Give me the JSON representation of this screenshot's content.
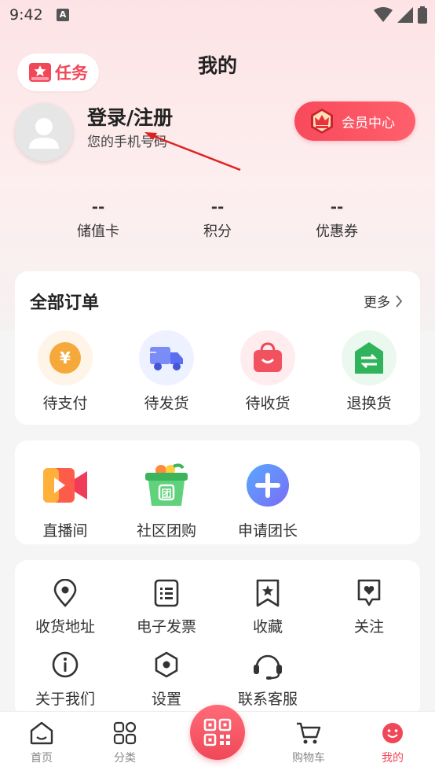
{
  "status": {
    "time": "9:42"
  },
  "header": {
    "task_label": "任务",
    "title": "我的"
  },
  "profile": {
    "login_label": "登录/注册",
    "phone_hint": "您的手机号码",
    "member_label": "会员中心"
  },
  "stats": [
    {
      "value": "--",
      "label": "储值卡"
    },
    {
      "value": "--",
      "label": "积分"
    },
    {
      "value": "--",
      "label": "优惠券"
    }
  ],
  "orders": {
    "title": "全部订单",
    "more": "更多",
    "items": [
      {
        "label": "待支付",
        "icon": "yen-icon"
      },
      {
        "label": "待发货",
        "icon": "truck-icon"
      },
      {
        "label": "待收货",
        "icon": "bag-icon"
      },
      {
        "label": "退换货",
        "icon": "exchange-icon"
      }
    ]
  },
  "features": {
    "items": [
      {
        "label": "直播间",
        "icon": "live-video-icon"
      },
      {
        "label": "社区团购",
        "icon": "group-buy-basket-icon"
      },
      {
        "label": "申请团长",
        "icon": "plus-icon"
      }
    ]
  },
  "services": {
    "items": [
      {
        "label": "收货地址",
        "icon": "location-pin-icon"
      },
      {
        "label": "电子发票",
        "icon": "invoice-icon"
      },
      {
        "label": "收藏",
        "icon": "bookmark-star-icon"
      },
      {
        "label": "关注",
        "icon": "heart-tag-icon"
      },
      {
        "label": "关于我们",
        "icon": "info-icon"
      },
      {
        "label": "设置",
        "icon": "settings-hex-icon"
      },
      {
        "label": "联系客服",
        "icon": "headset-icon"
      }
    ]
  },
  "tabbar": {
    "items": [
      {
        "label": "首页",
        "icon": "home-icon"
      },
      {
        "label": "分类",
        "icon": "grid-icon"
      },
      {
        "label": "购物车",
        "icon": "cart-icon"
      },
      {
        "label": "我的",
        "icon": "smile-icon"
      }
    ]
  },
  "colors": {
    "accent": "#f04858",
    "background": "#f5f5f5"
  }
}
